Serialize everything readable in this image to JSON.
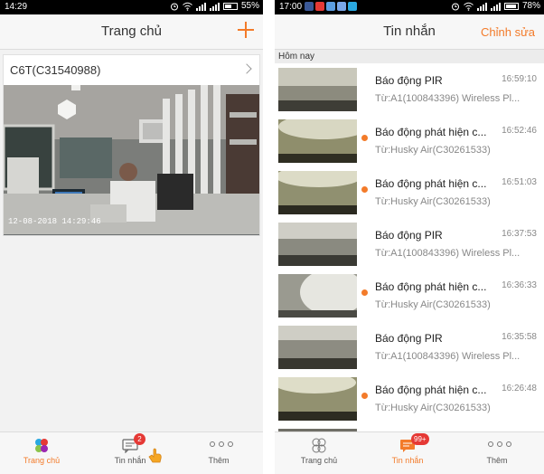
{
  "left_phone": {
    "status": {
      "time": "14:29",
      "battery": "55%"
    },
    "header": {
      "title": "Trang chủ"
    },
    "camera": {
      "name": "C6T(C31540988)",
      "timestamp": "12-08-2018 14:29:46"
    },
    "tabs": [
      {
        "label": "Trang chủ"
      },
      {
        "label": "Tin nhắn",
        "badge": "2"
      },
      {
        "label": "Thêm"
      }
    ]
  },
  "right_phone": {
    "status": {
      "time": "17:00",
      "battery": "78%"
    },
    "header": {
      "title": "Tin nhắn",
      "edit_label": "Chỉnh sửa"
    },
    "section_label": "Hôm nay",
    "messages": [
      {
        "title": "Báo động PIR",
        "time": "16:59:10",
        "from": "Từ:A1(100843396) Wireless Pl...",
        "unread": false
      },
      {
        "title": "Báo động phát hiện c...",
        "time": "16:52:46",
        "from": "Từ:Husky Air(C30261533)",
        "unread": true
      },
      {
        "title": "Báo động phát hiện c...",
        "time": "16:51:03",
        "from": "Từ:Husky Air(C30261533)",
        "unread": true
      },
      {
        "title": "Báo động PIR",
        "time": "16:37:53",
        "from": "Từ:A1(100843396) Wireless Pl...",
        "unread": false
      },
      {
        "title": "Báo động phát hiện c...",
        "time": "16:36:33",
        "from": "Từ:Husky Air(C30261533)",
        "unread": true
      },
      {
        "title": "Báo động PIR",
        "time": "16:35:58",
        "from": "Từ:A1(100843396) Wireless Pl...",
        "unread": false
      },
      {
        "title": "Báo động phát hiện c...",
        "time": "16:26:48",
        "from": "Từ:Husky Air(C30261533)",
        "unread": true
      }
    ],
    "tabs": [
      {
        "label": "Trang chủ"
      },
      {
        "label": "Tin nhắn",
        "badge": "99+"
      },
      {
        "label": "Thêm"
      }
    ]
  },
  "colors": {
    "accent": "#f37b2a",
    "badge": "#e53935"
  }
}
